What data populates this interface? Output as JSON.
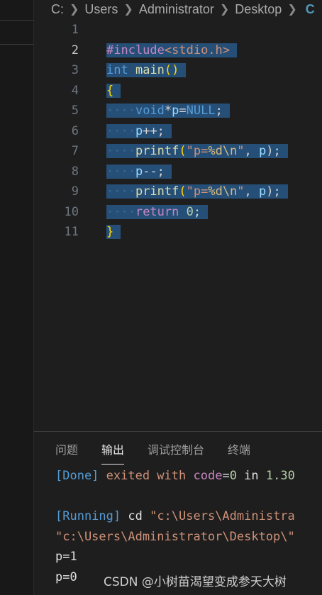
{
  "breadcrumb": {
    "items": [
      "C:",
      "Users",
      "Administrator",
      "Desktop"
    ],
    "file_icon": "C"
  },
  "editor": {
    "line_numbers": [
      "1",
      "2",
      "3",
      "4",
      "5",
      "6",
      "7",
      "8",
      "9",
      "10",
      "11"
    ],
    "active_line": 2,
    "lines": [
      [],
      [
        {
          "t": "#include",
          "c": "kw-purple"
        },
        {
          "t": "<stdio.h>",
          "c": "hdr"
        }
      ],
      [
        {
          "t": "int",
          "c": "kw-blue"
        },
        {
          "t": " ",
          "c": "plain"
        },
        {
          "t": "main",
          "c": "fn"
        },
        {
          "t": "()",
          "c": "bracket"
        }
      ],
      [
        {
          "t": "{",
          "c": "bracket"
        }
      ],
      [
        {
          "t": "····",
          "c": "ws"
        },
        {
          "t": "void",
          "c": "kw-blue"
        },
        {
          "t": "*",
          "c": "plain"
        },
        {
          "t": "p",
          "c": "var"
        },
        {
          "t": "=",
          "c": "plain"
        },
        {
          "t": "NULL",
          "c": "kw-blue"
        },
        {
          "t": ";",
          "c": "plain"
        }
      ],
      [
        {
          "t": "····",
          "c": "ws"
        },
        {
          "t": "p",
          "c": "var"
        },
        {
          "t": "++;",
          "c": "plain"
        }
      ],
      [
        {
          "t": "····",
          "c": "ws"
        },
        {
          "t": "printf",
          "c": "fn"
        },
        {
          "t": "(",
          "c": "bracket"
        },
        {
          "t": "\"p=",
          "c": "str"
        },
        {
          "t": "%d\\n",
          "c": "esc"
        },
        {
          "t": "\"",
          "c": "str"
        },
        {
          "t": ", ",
          "c": "plain"
        },
        {
          "t": "p",
          "c": "var"
        },
        {
          "t": ");",
          "c": "plain"
        }
      ],
      [
        {
          "t": "····",
          "c": "ws"
        },
        {
          "t": "p",
          "c": "var"
        },
        {
          "t": "--;",
          "c": "plain"
        }
      ],
      [
        {
          "t": "····",
          "c": "ws"
        },
        {
          "t": "printf",
          "c": "fn"
        },
        {
          "t": "(",
          "c": "bracket"
        },
        {
          "t": "\"p=",
          "c": "str"
        },
        {
          "t": "%d\\n",
          "c": "esc"
        },
        {
          "t": "\"",
          "c": "str"
        },
        {
          "t": ", ",
          "c": "plain"
        },
        {
          "t": "p",
          "c": "var"
        },
        {
          "t": ");",
          "c": "plain"
        }
      ],
      [
        {
          "t": "····",
          "c": "ws"
        },
        {
          "t": "return",
          "c": "kw-purple"
        },
        {
          "t": " ",
          "c": "plain"
        },
        {
          "t": "0",
          "c": "num"
        },
        {
          "t": ";",
          "c": "plain"
        }
      ],
      [
        {
          "t": "}",
          "c": "bracket"
        }
      ]
    ]
  },
  "panel": {
    "tabs": [
      {
        "label": "问题",
        "active": false
      },
      {
        "label": "输出",
        "active": true
      },
      {
        "label": "调试控制台",
        "active": false
      },
      {
        "label": "终端",
        "active": false
      }
    ],
    "output_lines": [
      [
        {
          "t": "[Done]",
          "c": "o-blue"
        },
        {
          "t": " exited with ",
          "c": "o-str"
        },
        {
          "t": "code",
          "c": "o-purple"
        },
        {
          "t": "=",
          "c": "o-white"
        },
        {
          "t": "0",
          "c": "o-num"
        },
        {
          "t": " in ",
          "c": "o-white"
        },
        {
          "t": "1.30",
          "c": "o-num"
        }
      ],
      [],
      [
        {
          "t": "[Running]",
          "c": "o-blue"
        },
        {
          "t": " cd ",
          "c": "o-white"
        },
        {
          "t": "\"c:\\Users\\Administra",
          "c": "o-str"
        }
      ],
      [
        {
          "t": "\"c:\\Users\\Administrator\\Desktop\\\"",
          "c": "o-str"
        }
      ],
      [
        {
          "t": "p=1",
          "c": "o-white"
        }
      ],
      [
        {
          "t": "p=0",
          "c": "o-white"
        }
      ]
    ]
  },
  "watermark": "CSDN @小树苗渴望变成参天大树",
  "colors": {
    "background": "#1e1e1e",
    "selection": "#264f78",
    "keyword": "#569cd6",
    "control": "#c586c0",
    "function": "#dcdcaa",
    "string": "#ce9178"
  }
}
